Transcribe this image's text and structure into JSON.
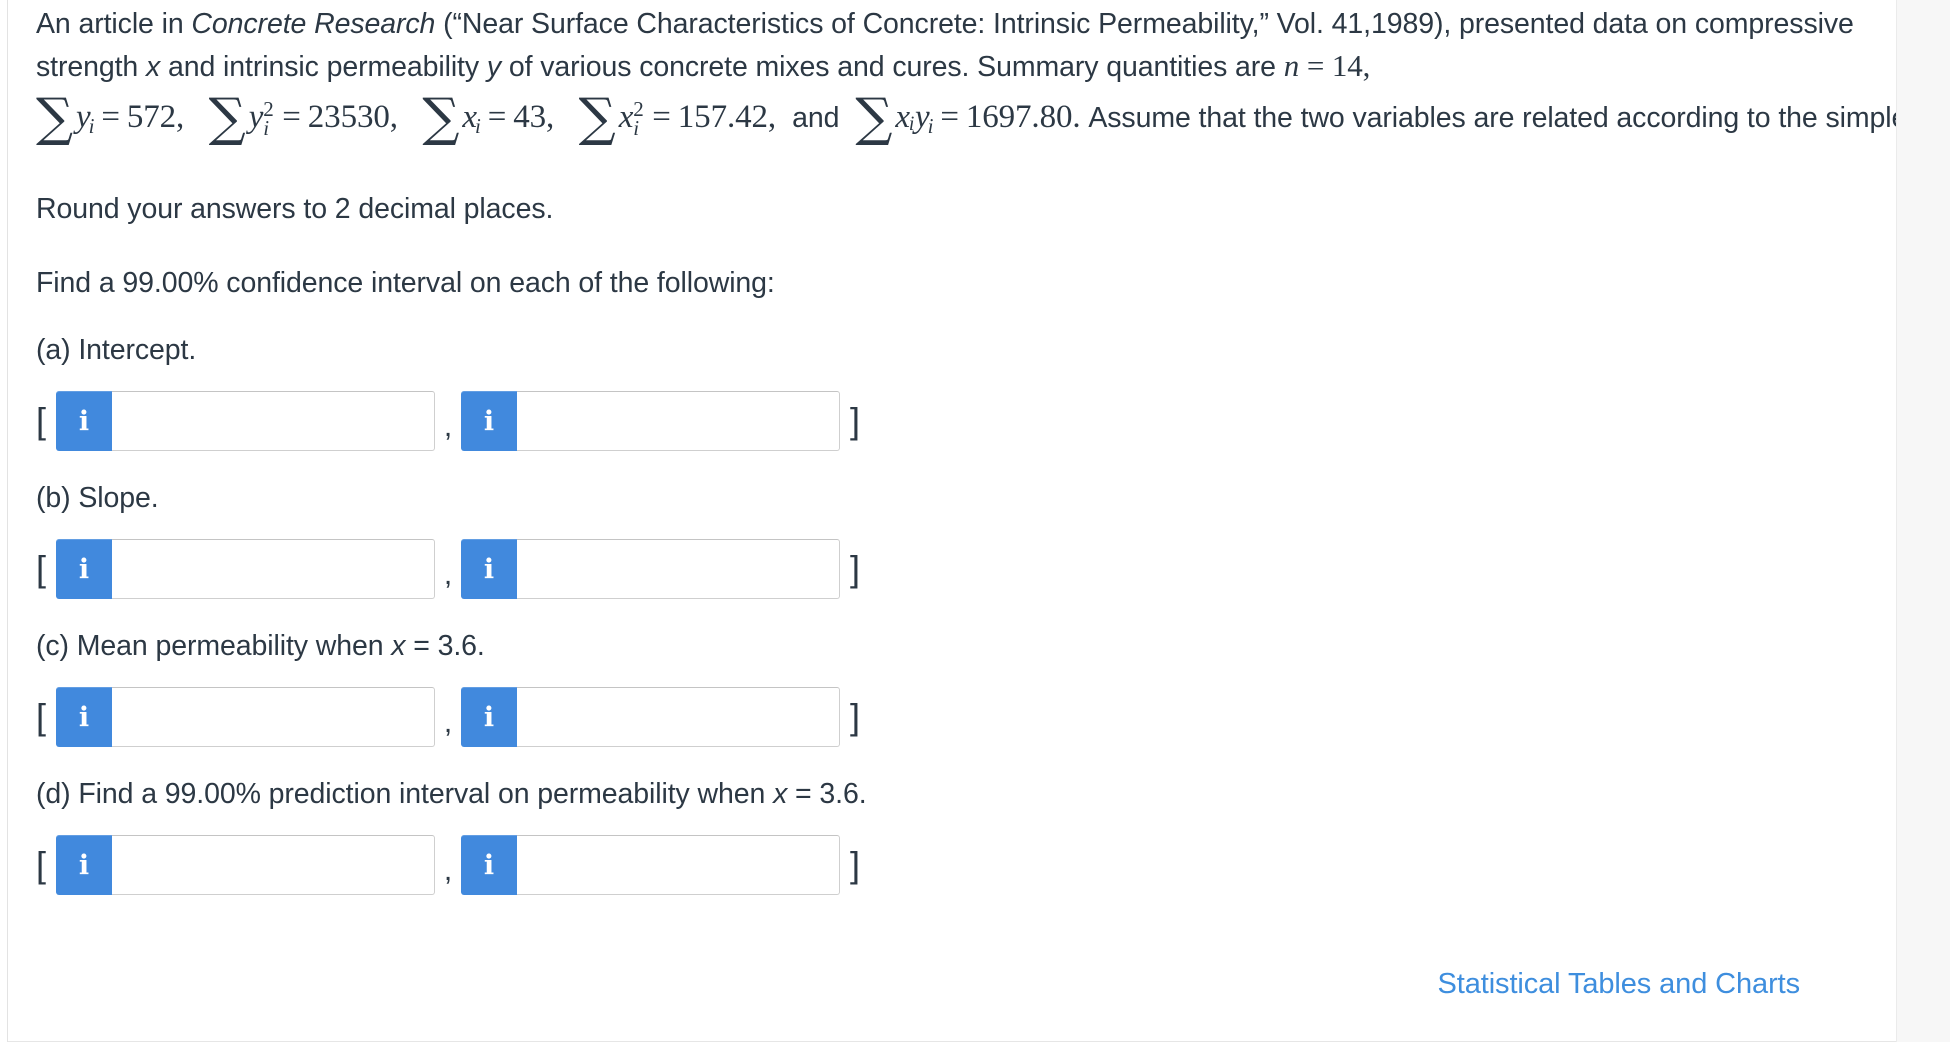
{
  "problem": {
    "intro_part1": "An article in ",
    "journal": "Concrete Research",
    "intro_part2": " (“Near Surface Characteristics of Concrete: Intrinsic Permeability,” Vol. 41,1989), presented data on compressive strength ",
    "var_x": "x",
    "intro_part3": " and intrinsic permeability ",
    "var_y": "y",
    "intro_part4": " of various concrete mixes and cures. Summary quantities are ",
    "n_symbol": "n",
    "n_value": "= 14,",
    "summaries": [
      {
        "sum_symbol": "∑",
        "variable": "y",
        "sub": "i",
        "sup": "",
        "equals": "=",
        "value": "572,",
        "kind": "sub"
      },
      {
        "sum_symbol": "∑",
        "variable": "y",
        "sub": "i",
        "sup": "2",
        "equals": "=",
        "value": "23530,",
        "kind": "subsup"
      },
      {
        "sum_symbol": "∑",
        "variable": "x",
        "sub": "i",
        "sup": "",
        "equals": "=",
        "value": "43,",
        "kind": "sub"
      },
      {
        "sum_symbol": "∑",
        "variable": "x",
        "sub": "i",
        "sup": "2",
        "equals": "=",
        "value": "157.42,",
        "kind": "subsup"
      },
      {
        "sum_symbol": "∑",
        "variable": "xᵢy",
        "sub": "i",
        "sup": "",
        "equals": "=",
        "value": "1697.80.",
        "kind": "sub"
      }
    ],
    "and_word": "and",
    "intro_tail": "Assume that the two variables are related according to the simple linear regression model.",
    "rounding_note": "Round your answers to 2 decimal places.",
    "instruction": "Find a 99.00% confidence interval on each of the following:"
  },
  "parts": [
    {
      "id": "a",
      "label": "(a) Intercept.",
      "open_bracket": "[",
      "comma": ",",
      "close_bracket": "]",
      "lower": {
        "badge_glyph": "i",
        "value": "",
        "placeholder": ""
      },
      "upper": {
        "badge_glyph": "i",
        "value": "",
        "placeholder": ""
      }
    },
    {
      "id": "b",
      "label": "(b) Slope.",
      "open_bracket": "[",
      "comma": ",",
      "close_bracket": "]",
      "lower": {
        "badge_glyph": "i",
        "value": "",
        "placeholder": ""
      },
      "upper": {
        "badge_glyph": "i",
        "value": "",
        "placeholder": ""
      }
    },
    {
      "id": "c",
      "label_pre": "(c) Mean permeability when ",
      "label_var": "x",
      "label_post": " = 3.6.",
      "open_bracket": "[",
      "comma": ",",
      "close_bracket": "]",
      "lower": {
        "badge_glyph": "i",
        "value": "",
        "placeholder": ""
      },
      "upper": {
        "badge_glyph": "i",
        "value": "",
        "placeholder": ""
      }
    },
    {
      "id": "d",
      "label_pre": "(d) Find a 99.00% prediction interval on permeability when ",
      "label_var": "x",
      "label_post": " = 3.6.",
      "open_bracket": "[",
      "comma": ",",
      "close_bracket": "]",
      "lower": {
        "badge_glyph": "i",
        "value": "",
        "placeholder": ""
      },
      "upper": {
        "badge_glyph": "i",
        "value": "",
        "placeholder": ""
      }
    }
  ],
  "footer": {
    "link_label": "Statistical Tables and Charts"
  },
  "colors": {
    "text": "#2c3844",
    "badge_blue": "#4189dd",
    "link_blue": "#3e8ede",
    "input_border": "#cfcfcf",
    "gutter": "#f7f7f7"
  }
}
